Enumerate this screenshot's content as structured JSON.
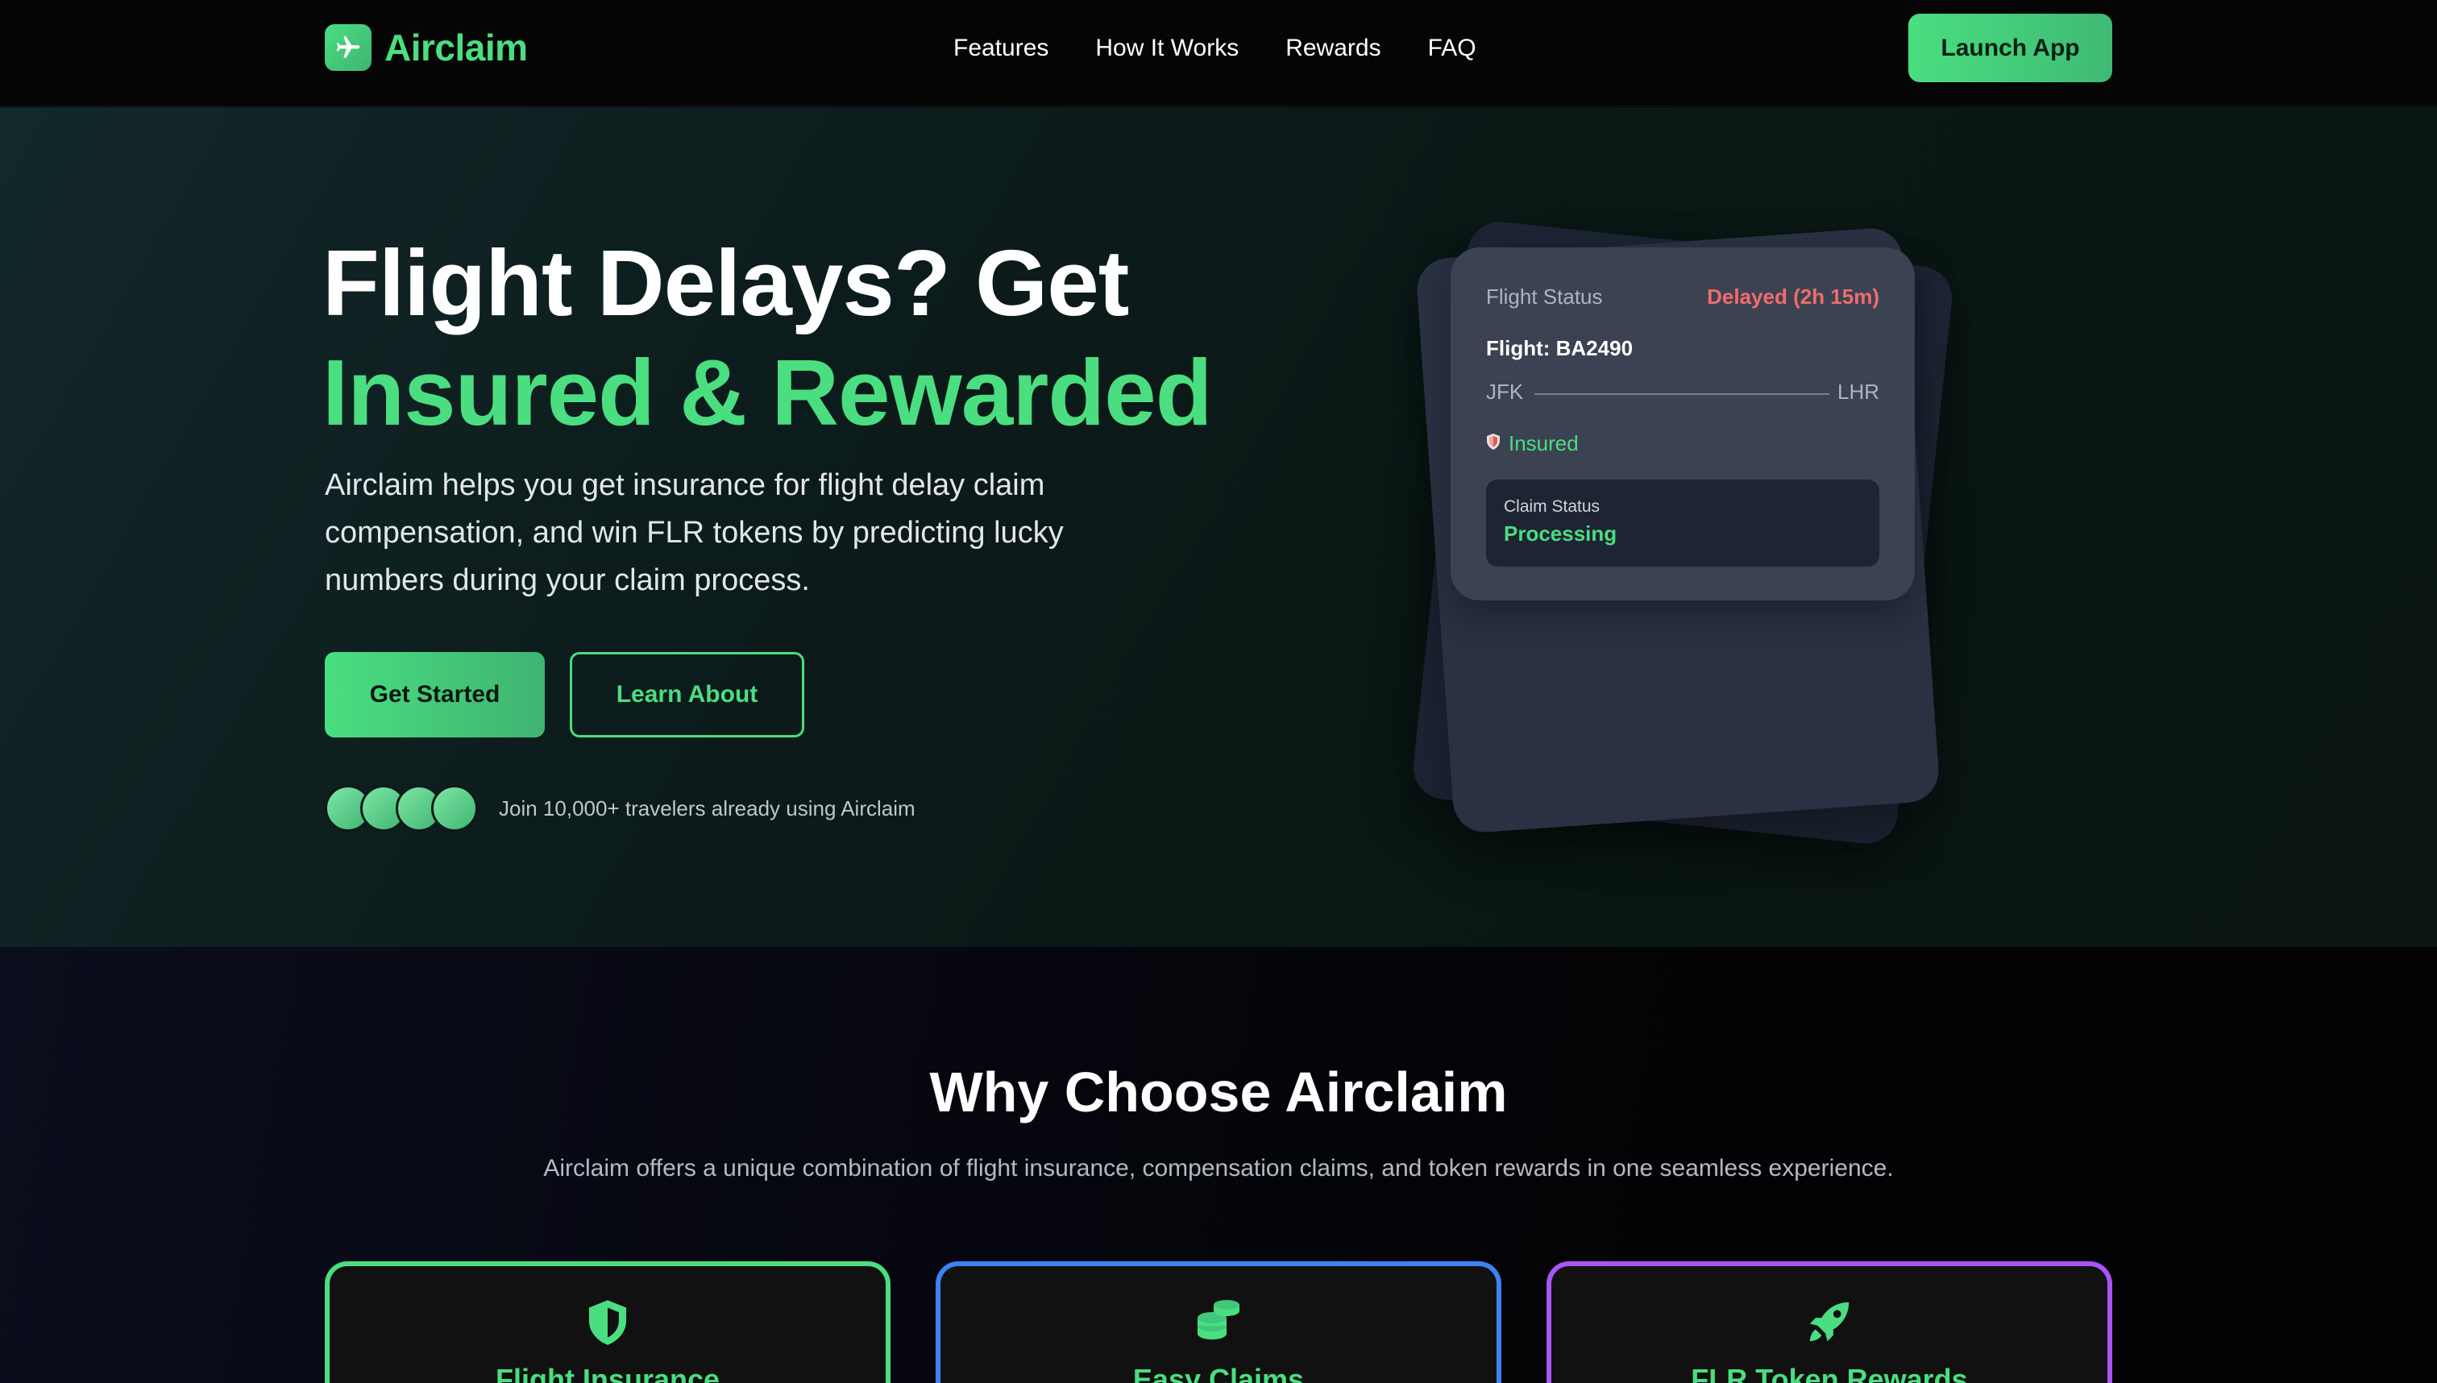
{
  "brand": {
    "name": "Airclaim",
    "icon": "plane-icon",
    "accent": "#4ade80"
  },
  "nav": {
    "links": [
      "Features",
      "How It Works",
      "Rewards",
      "FAQ"
    ],
    "cta": "Launch App"
  },
  "hero": {
    "title_line1": "Flight Delays? Get",
    "title_line2": "Insured & Rewarded",
    "description": "Airclaim helps you get insurance for flight delay claim compensation, and win FLR tokens by predicting lucky numbers during your claim process.",
    "primary_button": "Get Started",
    "secondary_button": "Learn About",
    "social_proof": "Join 10,000+ travelers already using Airclaim"
  },
  "flight_card": {
    "label": "Flight Status",
    "status": "Delayed (2h 15m)",
    "flight": "Flight: BA2490",
    "from": "JFK",
    "to": "LHR",
    "insured_label": "Insured",
    "claim_label": "Claim Status",
    "claim_value": "Processing",
    "status_color": "#f26b6b"
  },
  "features": {
    "title": "Why Choose Airclaim",
    "subtitle": "Airclaim offers a unique combination of flight insurance, compensation claims, and token rewards in one seamless experience.",
    "cards": [
      {
        "name": "Flight Insurance",
        "icon": "shield-icon",
        "color": "#4ade80"
      },
      {
        "name": "Easy Claims",
        "icon": "coins-icon",
        "color": "#3b82f6"
      },
      {
        "name": "FLR Token Rewards",
        "icon": "rocket-icon",
        "color": "#a855f7"
      }
    ]
  }
}
